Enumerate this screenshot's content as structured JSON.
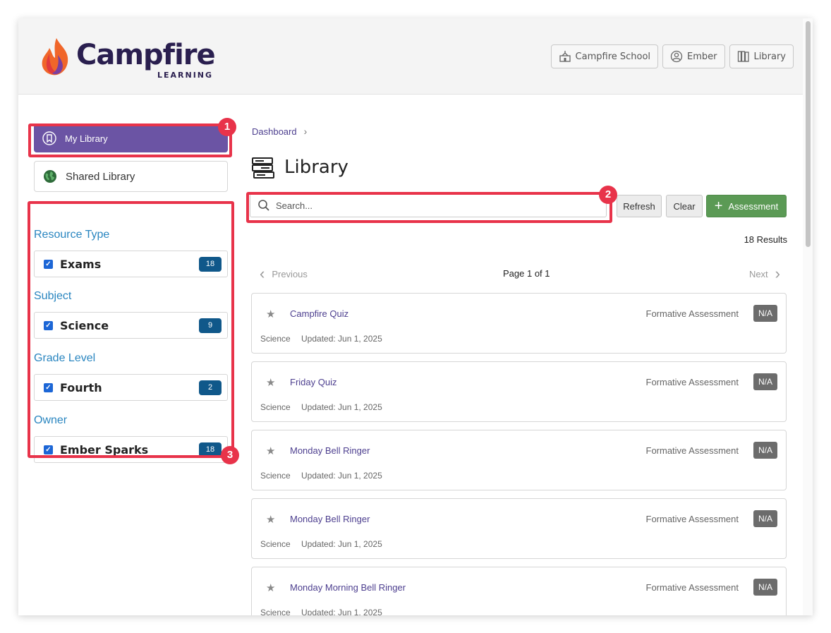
{
  "header": {
    "logo_word": "Campfire",
    "logo_sub": "LEARNING",
    "buttons": [
      {
        "label": "Campfire School",
        "icon": "school-icon"
      },
      {
        "label": "Ember",
        "icon": "user-circle-icon"
      },
      {
        "label": "Library",
        "icon": "library-icon"
      }
    ]
  },
  "sidebar": {
    "nav": [
      {
        "label": "My Library",
        "icon": "bookmark-icon",
        "active": true
      },
      {
        "label": "Shared Library",
        "icon": "globe-icon",
        "active": false
      }
    ],
    "facets": [
      {
        "title": "Resource Type",
        "item": "Exams",
        "count": "18"
      },
      {
        "title": "Subject",
        "item": "Science",
        "count": "9"
      },
      {
        "title": "Grade Level",
        "item": "Fourth",
        "count": "2"
      },
      {
        "title": "Owner",
        "item": "Ember Sparks",
        "count": "18"
      }
    ]
  },
  "main": {
    "breadcrumb": "Dashboard",
    "title": "Library",
    "search_placeholder": "Search...",
    "refresh_label": "Refresh",
    "clear_label": "Clear",
    "add_label": "Assessment",
    "results": "18 Results",
    "pager": {
      "previous": "Previous",
      "page": "Page 1 of 1",
      "next": "Next"
    },
    "cards": [
      {
        "title": "Campfire Quiz",
        "type": "Formative Assessment",
        "badge": "N/A",
        "subject": "Science",
        "updated": "Updated: Jun 1, 2025"
      },
      {
        "title": "Friday Quiz",
        "type": "Formative Assessment",
        "badge": "N/A",
        "subject": "Science",
        "updated": "Updated: Jun 1, 2025"
      },
      {
        "title": "Monday Bell Ringer",
        "type": "Formative Assessment",
        "badge": "N/A",
        "subject": "Science",
        "updated": "Updated: Jun 1, 2025"
      },
      {
        "title": "Monday Bell Ringer",
        "type": "Formative Assessment",
        "badge": "N/A",
        "subject": "Science",
        "updated": "Updated: Jun 1, 2025"
      },
      {
        "title": "Monday Morning Bell Ringer",
        "type": "Formative Assessment",
        "badge": "N/A",
        "subject": "Science",
        "updated": "Updated: Jun 1, 2025"
      }
    ]
  },
  "annotations": [
    "1",
    "2",
    "3"
  ],
  "colors": {
    "accent_purple": "#6b54a4",
    "annotation_red": "#e8334a",
    "count_blue": "#10588a",
    "add_green": "#5b9a55",
    "facet_title_blue": "#2a86c0"
  }
}
